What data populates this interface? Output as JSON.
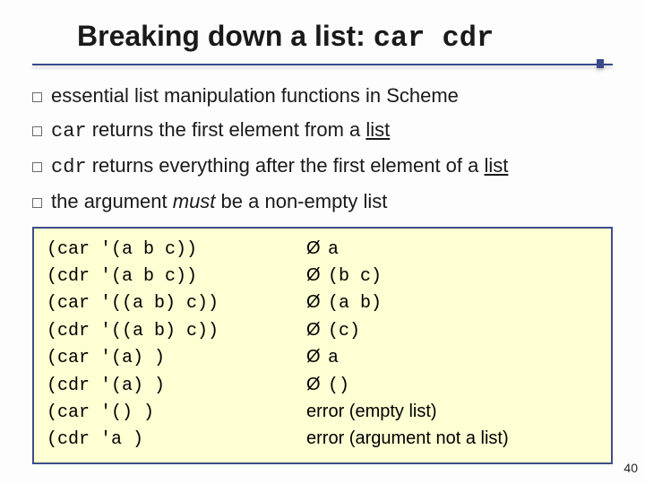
{
  "title": {
    "prefix": "Breaking down a list: ",
    "code": "car cdr"
  },
  "bullets": [
    {
      "pre": "essential list manipulation functions in Scheme",
      "code": "",
      "mid": "",
      "ul": "",
      "post": ""
    },
    {
      "pre": "",
      "code": "car",
      "mid": " returns the first element from a ",
      "ul": "list",
      "post": ""
    },
    {
      "pre": "",
      "code": "cdr",
      "mid": " returns everything after the first element of a ",
      "ul": "list",
      "post": ""
    },
    {
      "pre": "the argument ",
      "it": "must",
      "mid2": " be a non-empty list"
    }
  ],
  "examples": [
    {
      "lhs": "(car '(a b c))",
      "rhs": "a"
    },
    {
      "lhs": "(cdr '(a b c))",
      "rhs": "(b c)"
    },
    {
      "lhs": "(car '((a b) c))",
      "rhs": "(a b)"
    },
    {
      "lhs": "(cdr '((a b) c))",
      "rhs": "(c)"
    },
    {
      "lhs": "(car '(a) )",
      "rhs": "a"
    },
    {
      "lhs": "(cdr '(a) )",
      "rhs": "()"
    },
    {
      "lhs": "(car '() )",
      "err": "error (empty list)"
    },
    {
      "lhs": "(cdr 'a )",
      "err": "error (argument not a list)"
    }
  ],
  "arrow_glyph": "Ø",
  "page_num": "40"
}
